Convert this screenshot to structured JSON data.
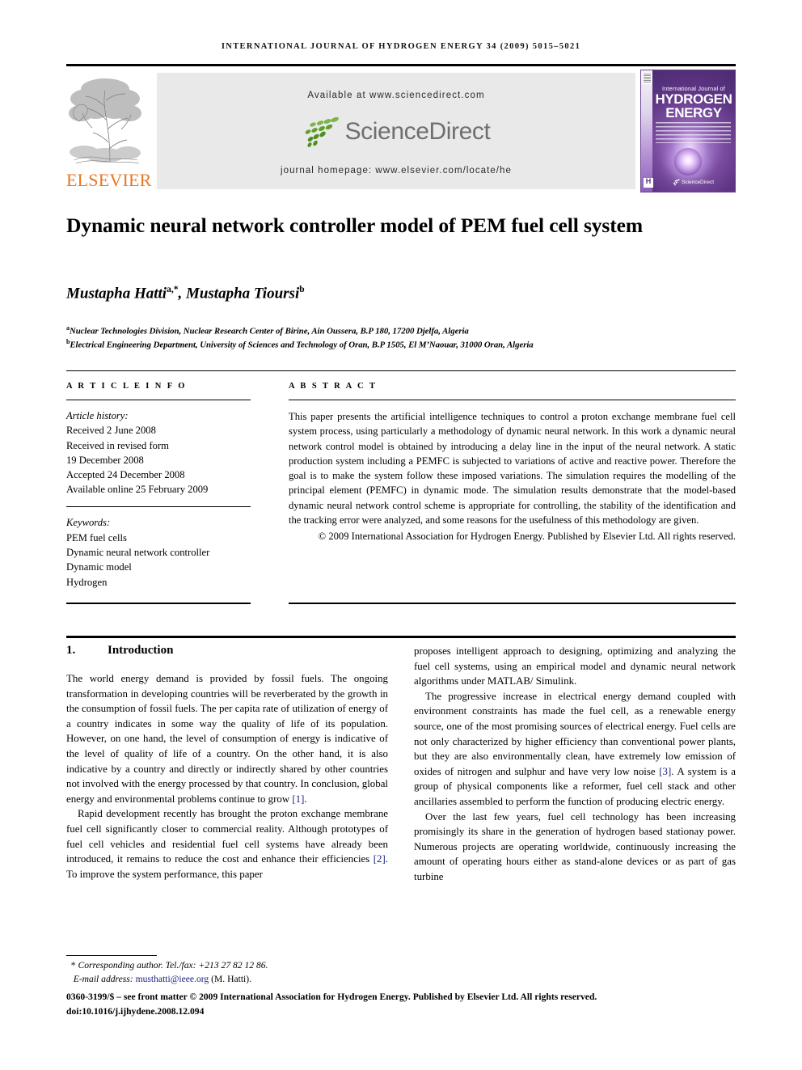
{
  "running_head": "INTERNATIONAL JOURNAL OF HYDROGEN ENERGY 34 (2009) 5015–5021",
  "masthead": {
    "publisher_word": "ELSEVIER",
    "available_at": "Available at www.sciencedirect.com",
    "sciencedirect_wordmark": "ScienceDirect",
    "journal_homepage": "journal homepage: www.elsevier.com/locate/he",
    "cover": {
      "line1": "International Journal of",
      "line2": "HYDROGEN",
      "line3": "ENERGY",
      "imprint": "ScienceDirect"
    },
    "colors": {
      "band_background": "#e9e9e9",
      "elsevier_orange": "#E87722",
      "sciencedirect_green": "#6aa92a",
      "sciencedirect_grey": "#6f6f6f",
      "cover_purple": "#7a4f9e"
    }
  },
  "article": {
    "title": "Dynamic neural network controller model of PEM fuel cell system",
    "authors_html": "Mustapha Hatti, Mustapha Tioursi",
    "author1_name": "Mustapha Hatti",
    "author1_sup": "a,*",
    "author2_name": "Mustapha Tioursi",
    "author2_sup": "b",
    "affiliation_a": "Nuclear Technologies Division, Nuclear Research Center of Birine, Ain Oussera, B.P 180, 17200 Djelfa, Algeria",
    "affiliation_a_mark": "a",
    "affiliation_b": "Electrical Engineering Department, University of Sciences and Technology of Oran, B.P 1505, El M’Naouar, 31000 Oran, Algeria",
    "affiliation_b_mark": "b"
  },
  "article_info": {
    "heading": "A R T I C L E   I N F O",
    "history_label": "Article history:",
    "history": [
      "Received 2 June 2008",
      "Received in revised form",
      "19 December 2008",
      "Accepted 24 December 2008",
      "Available online 25 February 2009"
    ],
    "keywords_label": "Keywords:",
    "keywords": [
      "PEM fuel cells",
      "Dynamic neural network controller",
      "Dynamic model",
      "Hydrogen"
    ]
  },
  "abstract": {
    "heading": "A B S T R A C T",
    "text": "This paper presents the artificial intelligence techniques to control a proton exchange membrane fuel cell system process, using particularly a methodology of dynamic neural network. In this work a dynamic neural network control model is obtained by introducing a delay line in the input of the neural network. A static production system including a PEMFC is subjected to variations of active and reactive power. Therefore the goal is to make the system follow these imposed variations. The simulation requires the modelling of the principal element (PEMFC) in dynamic mode. The simulation results demonstrate that the model-based dynamic neural network control scheme is appropriate for controlling, the stability of the identification and the tracking error were analyzed, and some reasons for the usefulness of this methodology are given.",
    "copyright": "© 2009 International Association for Hydrogen Energy. Published by Elsevier Ltd. All rights reserved."
  },
  "body": {
    "section_number": "1.",
    "section_title": "Introduction",
    "left_paragraph_1": "The world energy demand is provided by fossil fuels. The ongoing transformation in developing countries will be reverberated by the growth in the consumption of fossil fuels. The per capita rate of utilization of energy of a country indicates in some way the quality of life of its population. However, on one hand, the level of consumption of energy is indicative of the level of quality of life of a country. On the other hand, it is also indicative by a country and directly or indirectly shared by other countries not involved with the energy processed by that country. In conclusion, global energy and environmental problems continue to grow ",
    "left_paragraph_1_ref": "[1]",
    "left_paragraph_1_end": ".",
    "left_paragraph_2_a": "Rapid development recently has brought the proton exchange membrane fuel cell significantly closer to commercial reality. Although prototypes of fuel cell vehicles and residential fuel cell systems have already been introduced, it remains to reduce the cost and enhance their efficiencies ",
    "left_paragraph_2_ref": "[2]",
    "left_paragraph_2_b": ". To improve the system performance, this paper",
    "right_paragraph_1": "proposes intelligent approach to designing, optimizing and analyzing the fuel cell systems, using an empirical model and dynamic neural network algorithms under MATLAB/ Simulink.",
    "right_paragraph_2_a": "The progressive increase in electrical energy demand coupled with environment constraints has made the fuel cell, as a renewable energy source, one of the most promising sources of electrical energy. Fuel cells are not only characterized by higher efficiency than conventional power plants, but they are also environmentally clean, have extremely low emission of oxides of nitrogen and sulphur and have very low noise ",
    "right_paragraph_2_ref": "[3]",
    "right_paragraph_2_b": ". A system is a group of physical components like a reformer, fuel cell stack and other ancillaries assembled to perform the function of producing electric energy.",
    "right_paragraph_3": "Over the last few years, fuel cell technology has been increasing promisingly its share in the generation of hydrogen based stationay power. Numerous projects are operating worldwide, continuously increasing the amount of operating hours either as stand-alone devices or as part of gas turbine"
  },
  "footnote": {
    "star": "*",
    "corresponding": "Corresponding author. Tel./fax: +213 27 82 12 86.",
    "email_label": "E-mail address:",
    "email": "musthatti@ieee.org",
    "email_owner": "(M. Hatti).",
    "issn_line": "0360-3199/$ – see front matter © 2009 International Association for Hydrogen Energy. Published by Elsevier Ltd. All rights reserved.",
    "doi_line": "doi:10.1016/j.ijhydene.2008.12.094"
  }
}
